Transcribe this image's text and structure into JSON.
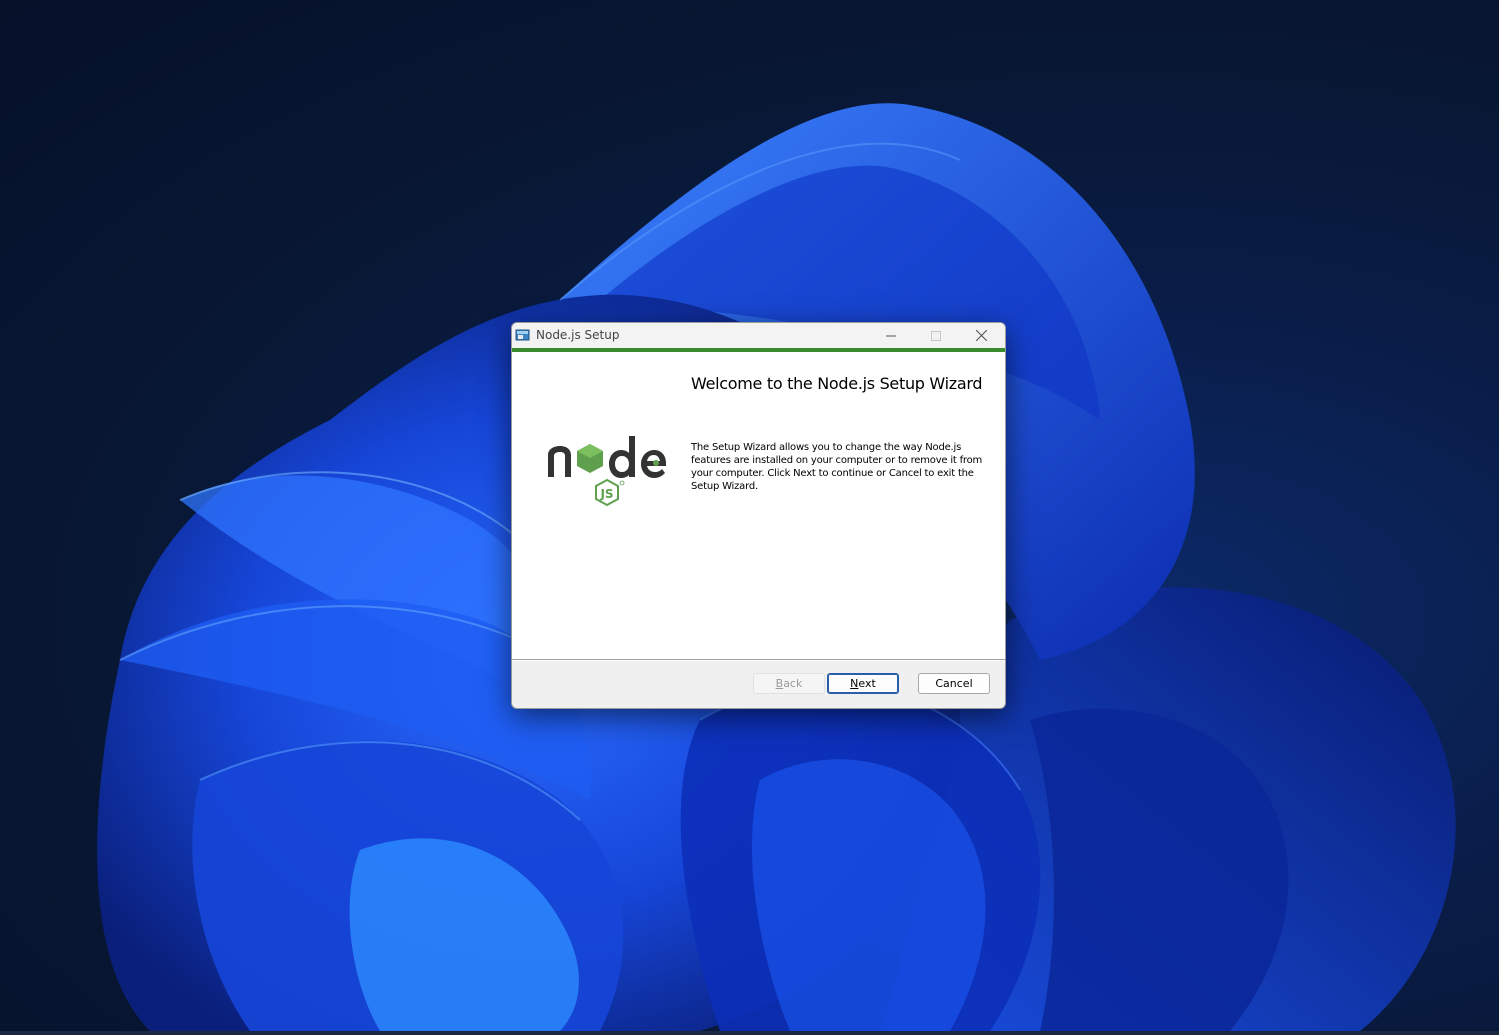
{
  "window": {
    "title": "Node.js Setup",
    "heading": "Welcome to the Node.js Setup Wizard",
    "description": "The Setup Wizard allows you to change the way Node.js features are installed on your computer or to remove it from your computer. Click Next to continue or Cancel to exit the Setup Wizard.",
    "accent_color": "#3a8a2f",
    "logo_text": "node js"
  },
  "buttons": {
    "back_first": "B",
    "back_rest": "ack",
    "next_first": "N",
    "next_rest": "ext",
    "cancel": "Cancel"
  },
  "icons": [
    "installer-icon",
    "minimize-icon",
    "maximize-icon",
    "close-icon",
    "nodejs-logo"
  ]
}
